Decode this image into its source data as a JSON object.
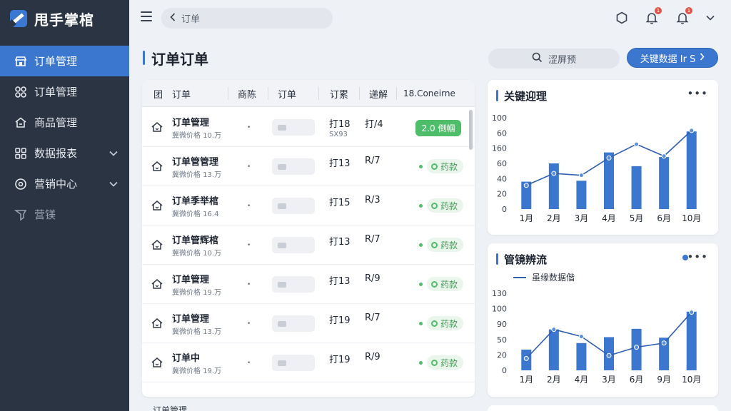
{
  "app": {
    "name": "甩手掌棺"
  },
  "sidebar": {
    "items": [
      {
        "label": "订单管理",
        "icon": "store-icon",
        "active": true
      },
      {
        "label": "订单管理",
        "icon": "link-icon"
      },
      {
        "label": "商品管理",
        "icon": "home-icon"
      },
      {
        "label": "数据报表",
        "icon": "grid-icon",
        "expandable": true
      },
      {
        "label": "营销中心",
        "icon": "target-icon",
        "expandable": true
      },
      {
        "label": "营镁",
        "icon": "filter-icon",
        "muted": true
      }
    ]
  },
  "header": {
    "breadcrumb": "订单",
    "notifications": [
      {
        "badge": "1"
      },
      {
        "badge": "1"
      }
    ]
  },
  "page": {
    "title": "订单订单",
    "search_label": "涩屏预",
    "primary_button": "关键数据 Ir S"
  },
  "table": {
    "columns": [
      "团",
      "订单",
      "商陈",
      "订单",
      "订累",
      "递解",
      "18.Coneirne"
    ],
    "rows": [
      {
        "name": "订单管理",
        "sub": "冀微价格 10.万",
        "amount": "打18",
        "amount_sub": "SX93",
        "method": "打/4",
        "status": "2.0 倒帼",
        "status_style": "solid"
      },
      {
        "name": "订单管管理",
        "sub": "冀微价格 13.万",
        "amount": "打13",
        "method": "R/7",
        "status": "药款",
        "status_style": "soft"
      },
      {
        "name": "订单季举棺",
        "sub": "冀微价格 16.4",
        "amount": "打15",
        "method": "R/3",
        "status": "药款",
        "status_style": "soft"
      },
      {
        "name": "订单管辉棺",
        "sub": "冀微价格 10.万",
        "amount": "打13",
        "method": "R/7",
        "status": "药款",
        "status_style": "soft"
      },
      {
        "name": "订单管理",
        "sub": "冀微价格 19.万",
        "amount": "打13",
        "method": "R/9",
        "status": "药款",
        "status_style": "soft"
      },
      {
        "name": "订单管理",
        "sub": "冀微价格 13.万",
        "amount": "打19",
        "method": "R/7",
        "status": "药款",
        "status_style": "soft"
      },
      {
        "name": "订单中",
        "sub": "冀微价格 19.万",
        "amount": "打19",
        "method": "R/9",
        "status": "药款",
        "status_style": "soft"
      }
    ],
    "next_row_peek": "订单管理"
  },
  "chart_data": [
    {
      "type": "bar",
      "title": "关键迎理",
      "categories": [
        "1月",
        "2月",
        "3月",
        "4月",
        "5月",
        "6月",
        "10月"
      ],
      "ylim": [
        0,
        100
      ],
      "ytick_labels": [
        "0",
        "20",
        "40",
        "60",
        "160",
        "60",
        "100"
      ],
      "series": [
        {
          "type": "bar",
          "values": [
            30,
            50,
            31,
            62,
            47,
            57,
            85
          ]
        },
        {
          "type": "line",
          "values": [
            26,
            39,
            37,
            56,
            71,
            58,
            86
          ]
        }
      ],
      "colors": {
        "bar": "#3b76cf",
        "line": "#2f5fb0"
      }
    },
    {
      "type": "bar",
      "title": "管镜辨流",
      "legend": "虽缘数据偕",
      "categories": [
        "1月",
        "2月",
        "4月",
        "3月",
        "6月",
        "9月",
        "10月"
      ],
      "ylim": [
        0,
        130
      ],
      "ytick_labels": [
        "0",
        "20",
        "50",
        "90",
        "100",
        "130"
      ],
      "series": [
        {
          "name": "虽缘数据偕",
          "type": "line",
          "values": [
            20,
            69,
            57,
            25,
            39,
            46,
            98
          ]
        },
        {
          "type": "bar",
          "values": [
            35,
            69,
            46,
            56,
            70,
            55,
            99
          ]
        }
      ],
      "colors": {
        "bar": "#3b76cf",
        "line": "#2f5fb0"
      }
    }
  ]
}
